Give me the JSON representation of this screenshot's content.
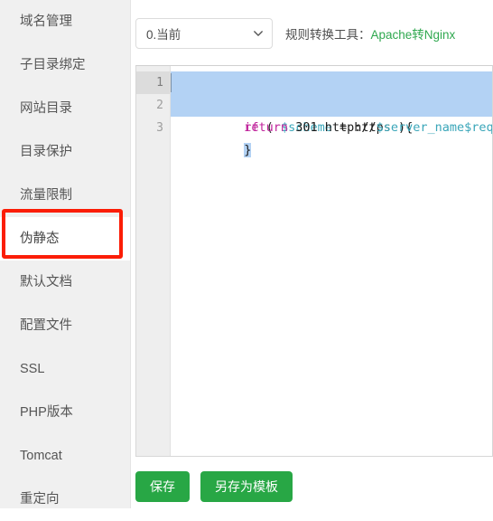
{
  "sidebar": {
    "items": [
      {
        "label": "域名管理",
        "active": false
      },
      {
        "label": "子目录绑定",
        "active": false
      },
      {
        "label": "网站目录",
        "active": false
      },
      {
        "label": "目录保护",
        "active": false
      },
      {
        "label": "流量限制",
        "active": false
      },
      {
        "label": "伪静态",
        "active": true
      },
      {
        "label": "默认文档",
        "active": false
      },
      {
        "label": "配置文件",
        "active": false
      },
      {
        "label": "SSL",
        "active": false
      },
      {
        "label": "PHP版本",
        "active": false
      },
      {
        "label": "Tomcat",
        "active": false
      },
      {
        "label": "重定向",
        "active": false
      }
    ],
    "highlight_color": "#fb1d06"
  },
  "toolbar": {
    "select": {
      "value": "0.当前",
      "icon": "chevron-down-icon"
    },
    "converter_label": "规则转换工具：",
    "converter_link": "Apache转Nginx",
    "link_color": "#2fa84f"
  },
  "editor": {
    "gutter": [
      "1",
      "2",
      "3"
    ],
    "lines": [
      {
        "number": "1",
        "tokens": [
          {
            "text": "if",
            "type": "kw"
          },
          {
            "text": " ( ",
            "type": "plain"
          },
          {
            "text": "$scheme",
            "type": "var"
          },
          {
            "text": " = https ){",
            "type": "plain"
          }
        ]
      },
      {
        "number": "2",
        "tokens": [
          {
            "text": "return",
            "type": "kw"
          },
          {
            "text": " ",
            "type": "plain"
          },
          {
            "text": "301",
            "type": "num"
          },
          {
            "text": " http://",
            "type": "plain"
          },
          {
            "text": "$server_name",
            "type": "var"
          },
          {
            "text": "$request_uri",
            "type": "var"
          },
          {
            "text": ";",
            "type": "punc"
          }
        ]
      },
      {
        "number": "3",
        "tokens": [
          {
            "text": "}",
            "type": "plain"
          }
        ]
      }
    ],
    "selection_color": "#b3d2f4",
    "active_line": "1"
  },
  "footer": {
    "save_label": "保存",
    "save_template_label": "另存为模板",
    "button_color": "#28a745"
  }
}
